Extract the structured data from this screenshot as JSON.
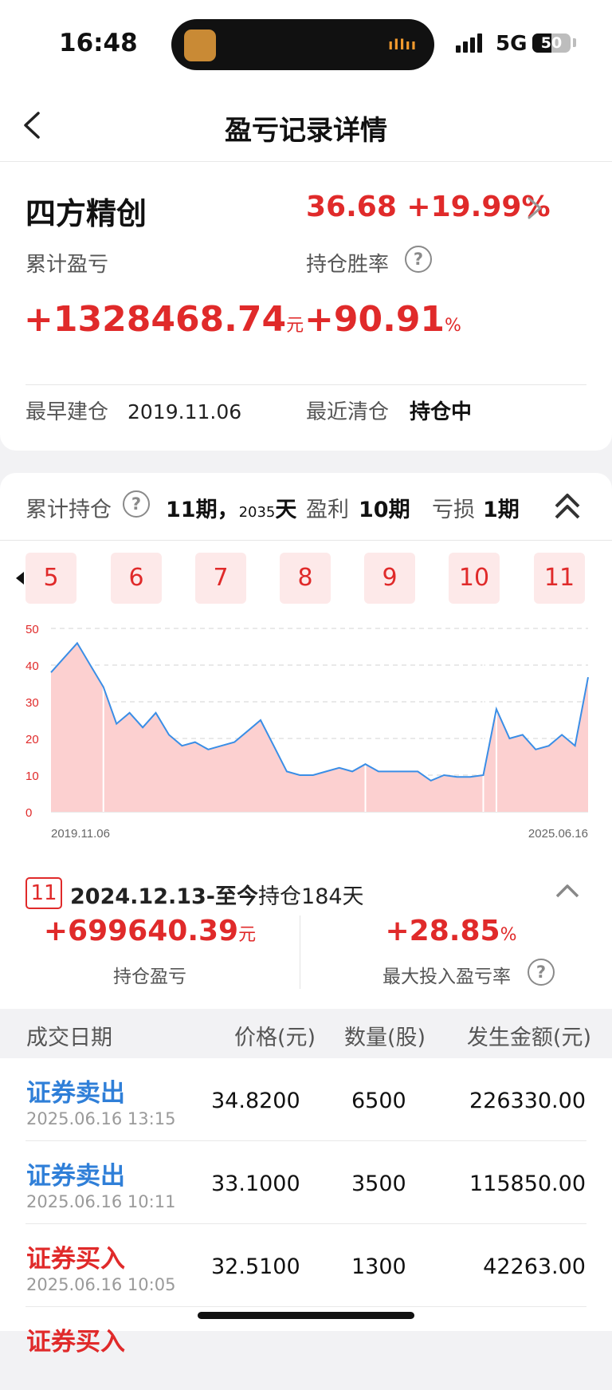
{
  "status": {
    "time": "16:48",
    "network": "5G",
    "battery": "50",
    "battery_level": 0.5
  },
  "nav": {
    "title": "盈亏记录详情"
  },
  "summary": {
    "stock_name": "四方精创",
    "price": "36.68 +19.99%",
    "cum_pnl_label": "累计盈亏",
    "cum_pnl_value": "+1328468.74",
    "cum_pnl_unit": "元",
    "win_rate_label": "持仓胜率",
    "win_rate_value": "+90.91",
    "win_rate_unit": "%",
    "first_open_label": "最早建仓",
    "first_open_value": "2019.11.06",
    "last_clear_label": "最近清仓",
    "last_clear_value": "持仓中"
  },
  "periods": {
    "hold_label": "累计持仓",
    "hold_count": "11期，",
    "hold_days_num": "2035",
    "hold_days_unit": "天",
    "profit_label": "盈利",
    "profit_value": "10期",
    "loss_label": "亏损",
    "loss_value": "1期",
    "tabs": [
      "5",
      "6",
      "7",
      "8",
      "9",
      "10",
      "11"
    ]
  },
  "chart_data": {
    "type": "area",
    "y_ticks": [
      "50",
      "40",
      "30",
      "20",
      "10",
      "0"
    ],
    "ylim": [
      0,
      50
    ],
    "x_start": "2019.11.06",
    "x_end": "2025.06.16",
    "series": [
      {
        "x": [
          "2019-11",
          "2020-01",
          "2020-02",
          "2020-03",
          "2020-05",
          "2020-07",
          "2020-08",
          "2020-10",
          "2020-12",
          "2021-02",
          "2021-04",
          "2021-06",
          "2021-08",
          "2021-10",
          "2021-12",
          "2022-02",
          "2022-03",
          "2022-05",
          "2022-07",
          "2022-09",
          "2022-11",
          "2023-01",
          "2023-03",
          "2023-05",
          "2023-07",
          "2023-09",
          "2023-11",
          "2024-01",
          "2024-02",
          "2024-04",
          "2024-06",
          "2024-08",
          "2024-09",
          "2024-10",
          "2024-11",
          "2024-12",
          "2025-01",
          "2025-02",
          "2025-03",
          "2025-04",
          "2025-05",
          "2025-06"
        ],
        "values": [
          38,
          42,
          46,
          40,
          34,
          24,
          27,
          23,
          27,
          21,
          18,
          19,
          17,
          18,
          19,
          22,
          25,
          18,
          11,
          10,
          10,
          11,
          12,
          11,
          13,
          11,
          11,
          11,
          11,
          8.5,
          10,
          9.5,
          9.5,
          10,
          28,
          20,
          21,
          17,
          18,
          21,
          18,
          36.7
        ]
      }
    ]
  },
  "current_period": {
    "badge": "11",
    "range": "2024.12.13-至今",
    "hold": "持仓184天",
    "pnl_value": "+699640.39",
    "pnl_unit": "元",
    "pnl_label": "持仓盈亏",
    "max_rate_value": "+28.85",
    "max_rate_unit": "%",
    "max_rate_label": "最大投入盈亏率"
  },
  "table": {
    "headers": [
      "成交日期",
      "价格(元)",
      "数量(股)",
      "发生金额(元)"
    ],
    "rows": [
      {
        "type": "证券卖出",
        "datetime": "2025.06.16 13:15",
        "price": "34.8200",
        "qty": "6500",
        "amount": "226330.00",
        "color": "#2f7fd8"
      },
      {
        "type": "证券卖出",
        "datetime": "2025.06.16 10:11",
        "price": "33.1000",
        "qty": "3500",
        "amount": "115850.00",
        "color": "#2f7fd8"
      },
      {
        "type": "证券买入",
        "datetime": "2025.06.16 10:05",
        "price": "32.5100",
        "qty": "1300",
        "amount": "42263.00",
        "color": "#e02a2a"
      },
      {
        "type": "证券买入",
        "datetime": "",
        "price": "",
        "qty": "",
        "amount": "",
        "color": "#e02a2a"
      }
    ]
  },
  "colors": {
    "red": "#e02a2a",
    "blue": "#2f7fd8",
    "area_fill": "#fcd0d0",
    "line": "#3a8ee6"
  }
}
